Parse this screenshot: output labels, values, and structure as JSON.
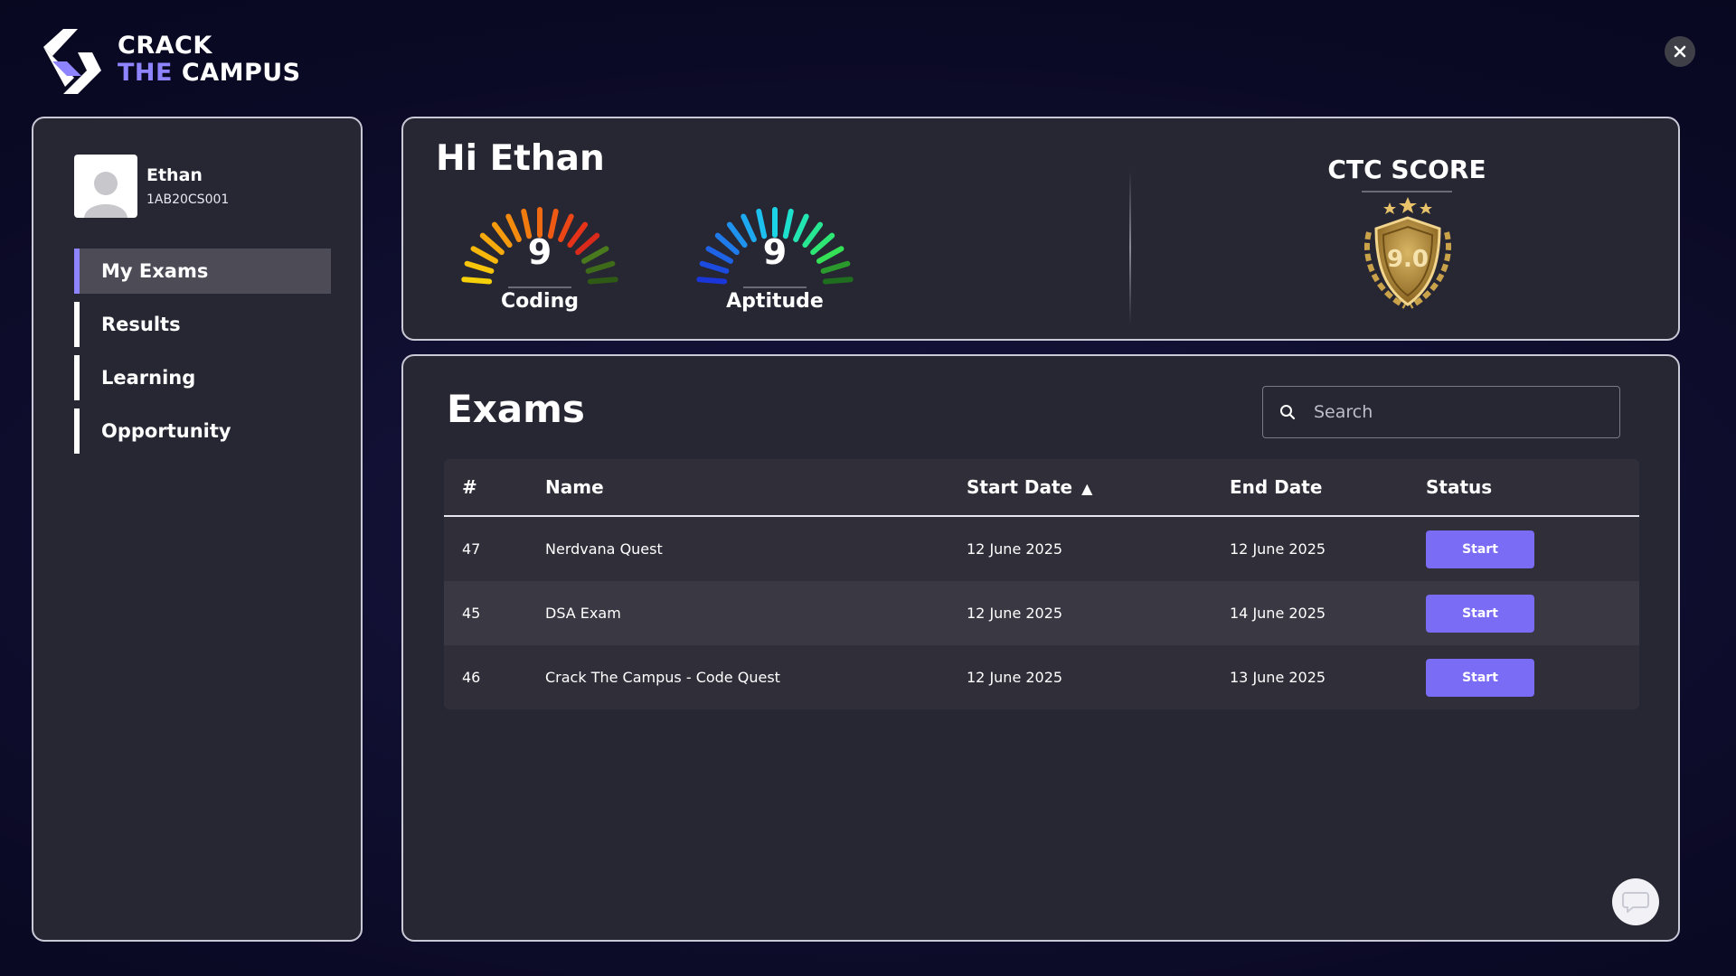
{
  "brand": {
    "line1": "CRACK",
    "line2a": "THE",
    "line2b": "CAMPUS",
    "accent": "#8f84ff"
  },
  "user": {
    "name": "Ethan",
    "id": "1AB20CS001",
    "greeting": "Hi Ethan"
  },
  "nav": {
    "items": [
      {
        "label": "My Exams",
        "active": true
      },
      {
        "label": "Results",
        "active": false
      },
      {
        "label": "Learning",
        "active": false
      },
      {
        "label": "Opportunity",
        "active": false
      }
    ]
  },
  "scores": {
    "coding": {
      "label": "Coding",
      "value": "9"
    },
    "aptitude": {
      "label": "Aptitude",
      "value": "9"
    },
    "ctc": {
      "title": "CTC SCORE",
      "value": "9.0"
    }
  },
  "exams": {
    "title": "Exams",
    "search_placeholder": "Search",
    "columns": {
      "num": "#",
      "name": "Name",
      "start": "Start Date",
      "end": "End Date",
      "status": "Status"
    },
    "rows": [
      {
        "num": "47",
        "name": "Nerdvana Quest",
        "start": "12 June 2025",
        "end": "12 June 2025",
        "action": "Start"
      },
      {
        "num": "45",
        "name": "DSA Exam",
        "start": "12 June 2025",
        "end": "14 June 2025",
        "action": "Start"
      },
      {
        "num": "46",
        "name": "Crack The Campus - Code Quest",
        "start": "12 June 2025",
        "end": "13 June 2025",
        "action": "Start"
      }
    ]
  },
  "icons": {
    "close": "close-icon",
    "search": "search-icon",
    "chat": "chat-icon",
    "sort": "sort-ascending-icon"
  }
}
